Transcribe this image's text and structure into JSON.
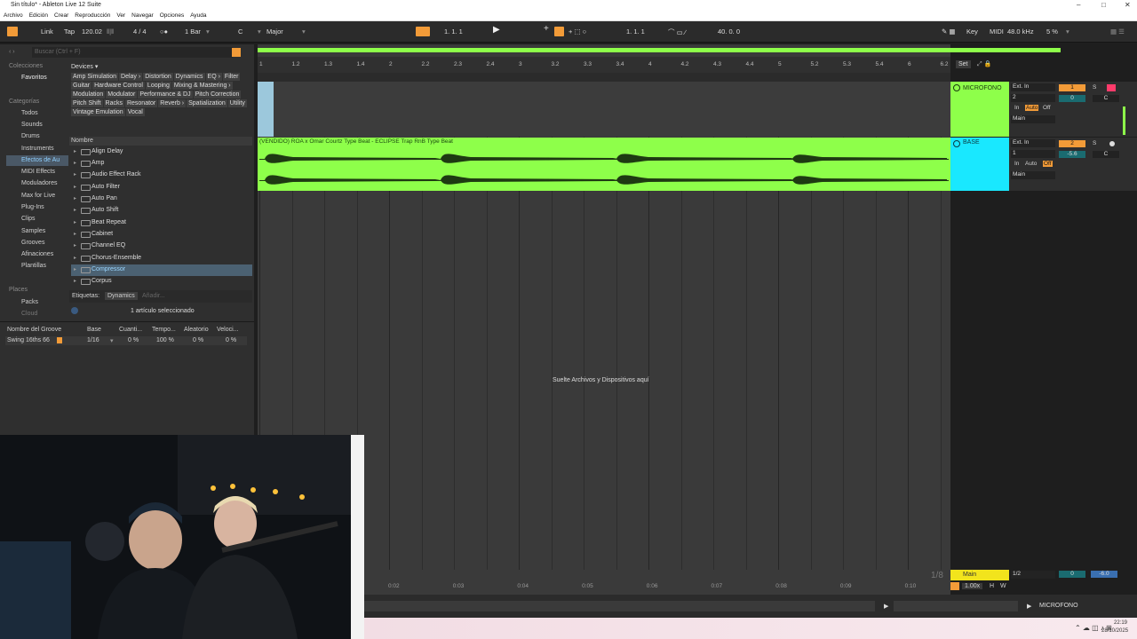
{
  "window": {
    "title": "Sin título* - Ableton Live 12 Suite",
    "controls": [
      "–",
      "□",
      "✕"
    ]
  },
  "menu": [
    "Archivo",
    "Edición",
    "Crear",
    "Reproducción",
    "Ver",
    "Navegar",
    "Opciones",
    "Ayuda"
  ],
  "transport": {
    "link": "Link",
    "tap": "Tap",
    "tempo": "120.02",
    "signature": "4 / 4",
    "quantize": "1 Bar",
    "key": "C",
    "scale": "Major",
    "position": "1.   1.   1",
    "loop_start": "1.   1.   1",
    "loop_length": "40.   0.   0",
    "key_label": "Key",
    "midi_label": "MIDI",
    "sample_rate": "48.0 kHz",
    "cpu": "5 %"
  },
  "browser": {
    "search_placeholder": "Buscar (Ctrl + F)",
    "collections_title": "Colecciones",
    "favorites": "Favoritos",
    "categories_title": "Categorías",
    "categories": [
      "Todos",
      "Sounds",
      "Drums",
      "Instruments",
      "Efectos de Au",
      "MIDI Effects",
      "Moduladores",
      "Max for Live",
      "Plug-Ins",
      "Clips",
      "Samples",
      "Grooves",
      "Afinaciones",
      "Plantillas"
    ],
    "places_title": "Places",
    "places": [
      "Packs",
      "Cloud"
    ],
    "devices_label": "Devices ▾",
    "device_tags": [
      "Amp Simulation",
      "Delay ›",
      "Distortion",
      "Dynamics",
      "EQ ›",
      "Filter",
      "Guitar",
      "Hardware Control",
      "Looping",
      "Mixing & Mastering ›",
      "Modulation",
      "Modulator",
      "Performance & DJ",
      "Pitch Correction",
      "Pitch Shift",
      "Racks",
      "Resonator",
      "Reverb ›",
      "Spatialization",
      "Utility",
      "Vintage Emulation",
      "Vocal"
    ],
    "name_header": "Nombre",
    "items": [
      "Align Delay",
      "Amp",
      "Audio Effect Rack",
      "Auto Filter",
      "Auto Pan",
      "Auto Shift",
      "Beat Repeat",
      "Cabinet",
      "Channel EQ",
      "Chorus-Ensemble",
      "Compressor",
      "Corpus"
    ],
    "selected_item": "Compressor",
    "tags_label": "Etiquetas:",
    "tag_value": "Dynamics",
    "tag_add": "Añadir...",
    "status": "1 artículo seleccionado"
  },
  "groove": {
    "headers": [
      "Nombre del Groove",
      "Base",
      "Cuanti...",
      "Tempo...",
      "Aleatorio",
      "Veloci..."
    ],
    "row": [
      "Swing 16ths 66",
      "1/16",
      "0 %",
      "100 %",
      "0 %",
      "0 %"
    ]
  },
  "arrangement": {
    "ruler": [
      "1",
      "1.2",
      "1.3",
      "1.4",
      "2",
      "2.2",
      "2.3",
      "2.4",
      "3",
      "3.2",
      "3.3",
      "3.4",
      "4",
      "4.2",
      "4.3",
      "4.4",
      "5",
      "5.2",
      "5.3",
      "5.4",
      "6",
      "6.2"
    ],
    "set_label": "Set",
    "clip_title": "(VENDIDO) ROA x Omar Courtz Type Beat - ECLIPSE  Trap RnB Type Beat",
    "drop_hint": "Suelte Archivos y Dispositivos aquí",
    "quantize_display": "1/8",
    "time_ticks": [
      "0:02",
      "0:03",
      "0:04",
      "0:05",
      "0:06",
      "0:07",
      "0:08",
      "0:09",
      "0:10"
    ]
  },
  "tracks": [
    {
      "name": "MICROFONO",
      "input": "Ext. In",
      "channel": "2",
      "in": "In",
      "auto": "Auto",
      "off": "Off",
      "out": "Main",
      "num": "1",
      "vol": "0",
      "pan": "C",
      "color": "#8eff4a"
    },
    {
      "name": "BASE",
      "input": "Ext. In",
      "channel": "1",
      "in": "In",
      "auto": "Auto",
      "off": "Off",
      "out": "Main",
      "num": "2",
      "vol": "-5.6",
      "pan": "C",
      "color": "#19e8ff"
    }
  ],
  "main_track": {
    "name": "Main",
    "send": "1/2",
    "vol": "0",
    "db": "-6.0",
    "zoom": "1.00x",
    "h": "H",
    "w": "W"
  },
  "footer": {
    "track_label": "MICROFONO"
  },
  "taskbar": {
    "time": "22:19",
    "date": "28/10/2025"
  }
}
